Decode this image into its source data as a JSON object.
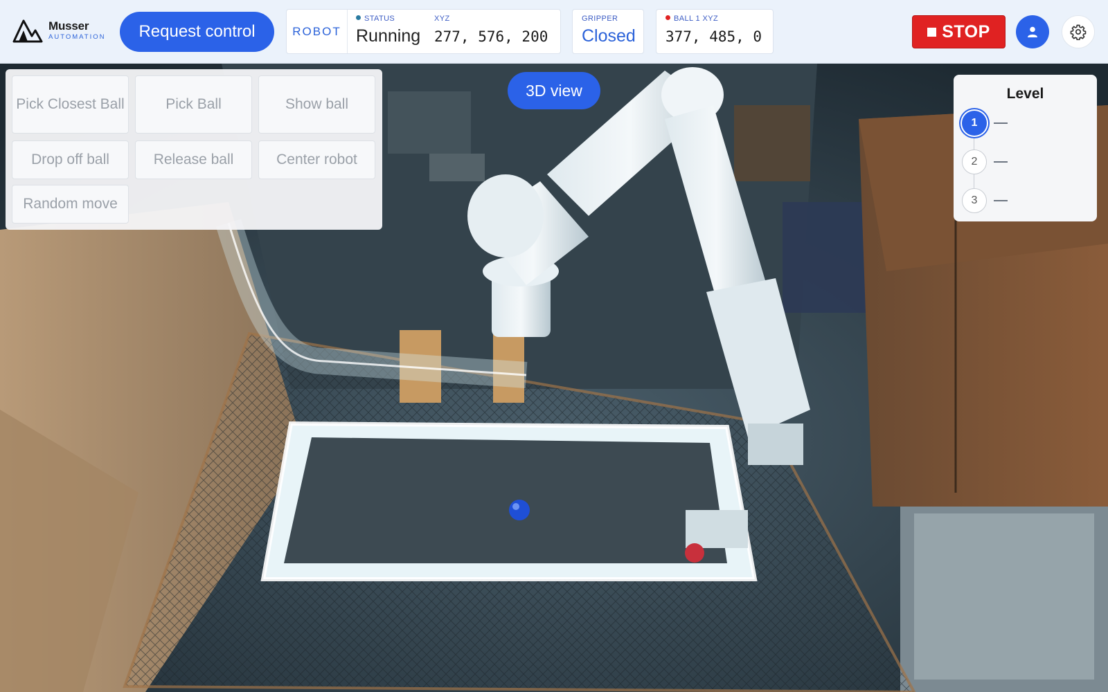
{
  "brand": {
    "name": "Musser",
    "sub": "AUTOMATION"
  },
  "header": {
    "request_label": "Request control",
    "robot_tag": "ROBOT",
    "status_label": "STATUS",
    "status_value": "Running",
    "xyz_label": "XYZ",
    "xyz_value": "277, 576, 200",
    "gripper_label": "GRIPPER",
    "gripper_value": "Closed",
    "ball_label": "BALL 1 XYZ",
    "ball_value": "377, 485, 0",
    "stop_label": "STOP"
  },
  "actions": [
    {
      "label": "Pick Closest Ball"
    },
    {
      "label": "Pick Ball"
    },
    {
      "label": "Show ball"
    },
    {
      "label": "Drop off ball"
    },
    {
      "label": "Release ball"
    },
    {
      "label": "Center robot"
    },
    {
      "label": "Random move"
    }
  ],
  "view_toggle_label": "3D view",
  "level": {
    "title": "Level",
    "items": [
      {
        "number": "1"
      },
      {
        "number": "2"
      },
      {
        "number": "3"
      }
    ],
    "active": "1"
  },
  "colors": {
    "accent": "#2b62e8",
    "stop": "#e02222",
    "status_dot": "#2a7aa0",
    "ball_dot": "#e02222"
  },
  "icons": [
    "musser-logo-icon",
    "stop-square-icon",
    "user-icon",
    "gear-icon"
  ]
}
